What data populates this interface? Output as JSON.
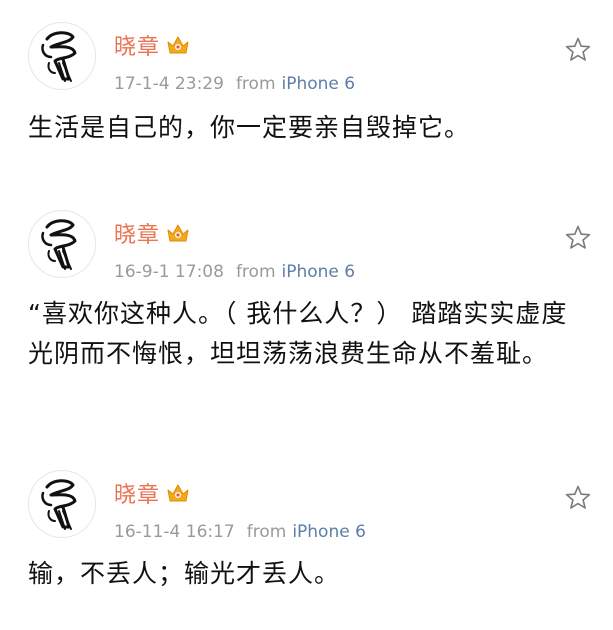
{
  "icons": {
    "avatar": "avatar-sketch-icon",
    "badge": "crown-member-icon",
    "favorite": "star-outline-icon"
  },
  "colors": {
    "username": "#eb7350",
    "meta": "#9a9a9a",
    "device": "#5d7ea6",
    "badge": "#f4a91c"
  },
  "posts": [
    {
      "username": "晓章",
      "date": "17-1-4 23:29",
      "from_label": "from",
      "device": "iPhone 6",
      "text": "生活是自己的，你一定要亲自毁掉它。"
    },
    {
      "username": "晓章",
      "date": "16-9-1 17:08",
      "from_label": "from",
      "device": "iPhone 6",
      "text": "“喜欢你这种人。（ 我什么人？） 踏踏实实虚度光阴而不悔恨，坦坦荡荡浪费生命从不羞耻。"
    },
    {
      "username": "晓章",
      "date": "16-11-4 16:17",
      "from_label": "from",
      "device": "iPhone 6",
      "text": "输，不丢人；输光才丢人。"
    }
  ]
}
